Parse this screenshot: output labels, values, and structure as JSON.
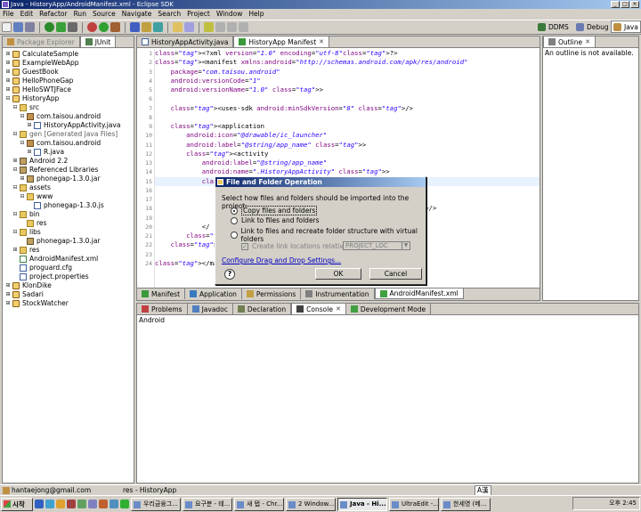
{
  "window": {
    "title": "Java - HistoryApp/AndroidManifest.xml - Eclipse SDK"
  },
  "menu": [
    "File",
    "Edit",
    "Refactor",
    "Run",
    "Source",
    "Navigate",
    "Search",
    "Project",
    "Window",
    "Help"
  ],
  "perspectives": {
    "ddms": "DDMS",
    "debug": "Debug",
    "java": "Java"
  },
  "explorer": {
    "tabs": [
      "Package Explorer",
      "JUnit"
    ],
    "rows": [
      {
        "depth": 0,
        "twisty": "+",
        "icon": "proj",
        "label": "CalculateSample"
      },
      {
        "depth": 0,
        "twisty": "+",
        "icon": "proj",
        "label": "ExampleWebApp"
      },
      {
        "depth": 0,
        "twisty": "+",
        "icon": "proj",
        "label": "GuestBook"
      },
      {
        "depth": 0,
        "twisty": "+",
        "icon": "proj",
        "label": "HelloPhoneGap"
      },
      {
        "depth": 0,
        "twisty": "+",
        "icon": "proj",
        "label": "HelloSWTJFace"
      },
      {
        "depth": 0,
        "twisty": "-",
        "icon": "proj",
        "label": "HistoryApp"
      },
      {
        "depth": 1,
        "twisty": "-",
        "icon": "folder",
        "label": "src"
      },
      {
        "depth": 2,
        "twisty": "-",
        "icon": "pkg",
        "label": "com.taisou.android"
      },
      {
        "depth": 3,
        "twisty": "+",
        "icon": "jfile",
        "label": "HistoryAppActivity.java"
      },
      {
        "depth": 1,
        "twisty": "-",
        "icon": "folder",
        "label": "gen [Generated Java Files]",
        "dim": true
      },
      {
        "depth": 2,
        "twisty": "-",
        "icon": "pkg",
        "label": "com.taisou.android"
      },
      {
        "depth": 3,
        "twisty": "+",
        "icon": "jfile",
        "label": "R.java"
      },
      {
        "depth": 1,
        "twisty": "+",
        "icon": "jar",
        "label": "Android 2.2"
      },
      {
        "depth": 1,
        "twisty": "-",
        "icon": "jar",
        "label": "Referenced Libraries"
      },
      {
        "depth": 2,
        "twisty": "+",
        "icon": "jar",
        "label": "phonegap-1.3.0.jar"
      },
      {
        "depth": 1,
        "twisty": "-",
        "icon": "folder",
        "label": "assets"
      },
      {
        "depth": 2,
        "twisty": "-",
        "icon": "folder",
        "label": "www"
      },
      {
        "depth": 3,
        "twisty": "",
        "icon": "jfile",
        "label": "phonegap-1.3.0.js"
      },
      {
        "depth": 1,
        "twisty": "-",
        "icon": "folder",
        "label": "bin"
      },
      {
        "depth": 2,
        "twisty": "",
        "icon": "folder",
        "label": "res"
      },
      {
        "depth": 1,
        "twisty": "-",
        "icon": "folder",
        "label": "libs"
      },
      {
        "depth": 2,
        "twisty": "",
        "icon": "jar",
        "label": "phonegap-1.3.0.jar"
      },
      {
        "depth": 1,
        "twisty": "+",
        "icon": "folder",
        "label": "res"
      },
      {
        "depth": 1,
        "twisty": "",
        "icon": "xmlf",
        "label": "AndroidManifest.xml"
      },
      {
        "depth": 1,
        "twisty": "",
        "icon": "jfile",
        "label": "proguard.cfg"
      },
      {
        "depth": 1,
        "twisty": "",
        "icon": "jfile",
        "label": "project.properties"
      },
      {
        "depth": 0,
        "twisty": "+",
        "icon": "proj",
        "label": "KlonDike"
      },
      {
        "depth": 0,
        "twisty": "+",
        "icon": "proj",
        "label": "Sadari"
      },
      {
        "depth": 0,
        "twisty": "+",
        "icon": "proj",
        "label": "StockWatcher"
      }
    ]
  },
  "editor": {
    "tabs": [
      "HistoryAppActivity.java",
      "HistoryApp Manifest"
    ],
    "bottom_tabs": [
      "Manifest",
      "Application",
      "Permissions",
      "Instrumentation",
      "AndroidManifest.xml"
    ],
    "lines": [
      "<?xml version=\"1.0\" encoding=\"utf-8\"?>",
      "<manifest xmlns:android=\"http://schemas.android.com/apk/res/android\"",
      "    package=\"com.taisou.android\"",
      "    android:versionCode=\"1\"",
      "    android:versionName=\"1.0\" >",
      "",
      "    <uses-sdk android:minSdkVersion=\"8\" />",
      "",
      "    <application",
      "        android:icon=\"@drawable/ic_launcher\"",
      "        android:label=\"@string/app_name\" >",
      "        <activity",
      "            android:label=\"@string/app_name\"",
      "            android:name=\".HistoryAppActivity\" >",
      "            <intent-filter >",
      "",
      "",
      "                                                    CHER\" />",
      "",
      "            </",
      "        </acti",
      "    </applicat",
      "",
      "</manifest>"
    ]
  },
  "outline": {
    "tab": "Outline",
    "message": "An outline is not available."
  },
  "console": {
    "tabs": [
      "Problems",
      "Javadoc",
      "Declaration",
      "Console",
      "Development Mode"
    ],
    "text": "Android"
  },
  "dialog": {
    "title": "File and Folder Operation",
    "question": "Select how files and folders should be imported into the project:",
    "options": [
      "Copy files and folders",
      "Link to files and folders",
      "Link to files and recreate folder structure with virtual folders"
    ],
    "selected": 0,
    "checkbox_label": "Create link locations relative to:",
    "combo_value": "PROJECT_LOC",
    "link": "Configure Drag and Drop Settings...",
    "ok": "OK",
    "cancel": "Cancel"
  },
  "status": {
    "user": "hantaejong@gmail.com",
    "path": "res - HistoryApp",
    "ime": "A漢"
  },
  "taskbar": {
    "start": "시작",
    "tasks": [
      "우리금융그...",
      "요구분 - 테...",
      "새 탭 - Chr...",
      "2 Window...",
      "Java - Hi...",
      "UltraEdit -...",
      "한세영 (메..."
    ],
    "active": 4,
    "clock": "오후 2:45"
  }
}
